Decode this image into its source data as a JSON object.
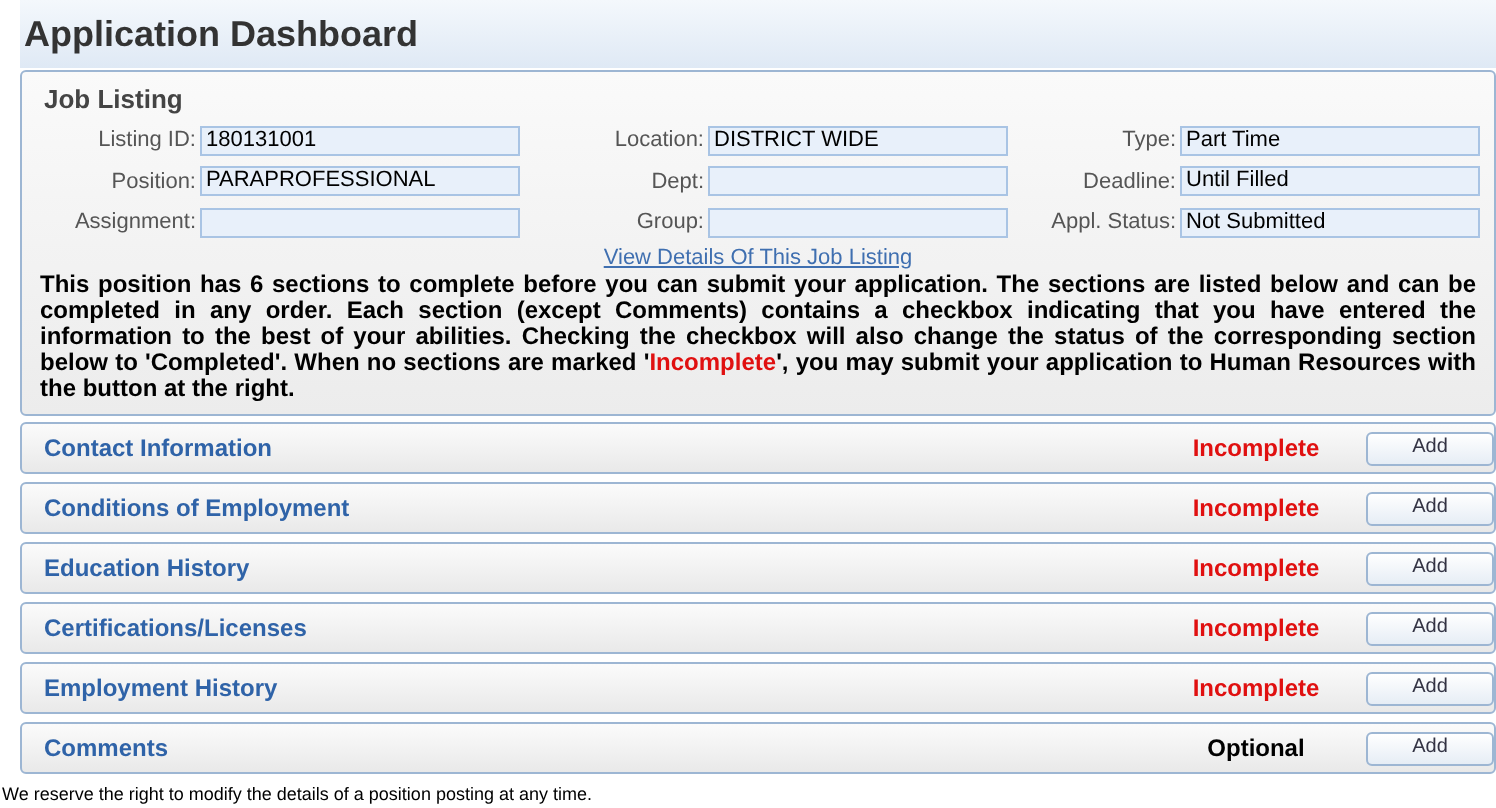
{
  "page_title": "Application Dashboard",
  "job_listing": {
    "title": "Job Listing",
    "fields": [
      {
        "label": "Listing ID:",
        "value": "180131001"
      },
      {
        "label": "Location:",
        "value": "DISTRICT WIDE"
      },
      {
        "label": "Type:",
        "value": "Part Time"
      },
      {
        "label": "Position:",
        "value": "PARAPROFESSIONAL"
      },
      {
        "label": "Dept:"
      },
      {
        "label": "Deadline:",
        "value": "Until Filled"
      },
      {
        "label": "Assignment:"
      },
      {
        "label": "Group:"
      },
      {
        "label": "Appl. Status:",
        "value": "Not Submitted"
      }
    ],
    "details_link": "View Details Of This Job Listing",
    "instructions": {
      "before": "This position has 6 sections to complete before you can submit your application. The sections are listed below and can be completed in any order. Each section (except Comments) contains a checkbox indicating that you have entered the information to the best of your abilities. Checking the checkbox will also change the status of the corresponding section below to 'Completed'. When no sections are marked '",
      "highlight": "Incomplete",
      "after": "', you may submit your application to Human Resources with the button at the right."
    }
  },
  "sections": [
    {
      "name": "Contact Information",
      "status": "Incomplete",
      "kind": "required",
      "button": "Add"
    },
    {
      "name": "Conditions of Employment",
      "status": "Incomplete",
      "kind": "required",
      "button": "Add"
    },
    {
      "name": "Education History",
      "status": "Incomplete",
      "kind": "required",
      "button": "Add"
    },
    {
      "name": "Certifications/Licenses",
      "status": "Incomplete",
      "kind": "required",
      "button": "Add"
    },
    {
      "name": "Employment History",
      "status": "Incomplete",
      "kind": "required",
      "button": "Add"
    },
    {
      "name": "Comments",
      "status": "Optional",
      "kind": "optional",
      "button": "Add"
    }
  ],
  "footer": "We reserve the right to modify the details of a position posting at any time."
}
